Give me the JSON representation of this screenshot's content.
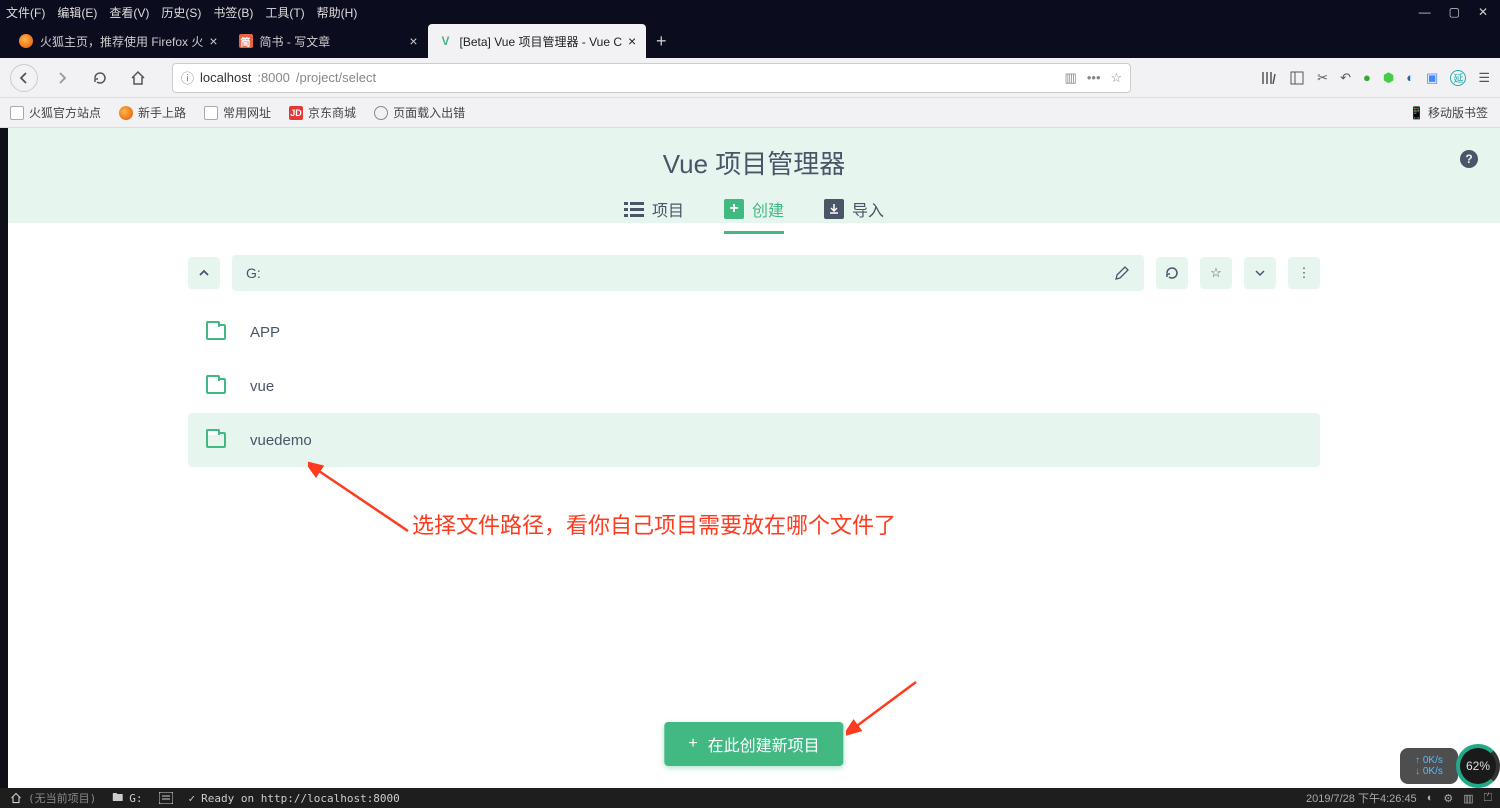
{
  "menubar": {
    "items": [
      "文件(F)",
      "编辑(E)",
      "查看(V)",
      "历史(S)",
      "书签(B)",
      "工具(T)",
      "帮助(H)"
    ]
  },
  "tabs": {
    "t0": {
      "title": "火狐主页，推荐使用 Firefox 火"
    },
    "t1": {
      "title": "简书 - 写文章"
    },
    "t2": {
      "title": "[Beta] Vue 项目管理器 - Vue C"
    }
  },
  "url": {
    "host": "localhost",
    "port": ":8000",
    "path": "/project/select"
  },
  "bookmarks": {
    "b0": "火狐官方站点",
    "b1": "新手上路",
    "b2": "常用网址",
    "b3": "京东商城",
    "b4": "页面载入出错",
    "mobile": "移动版书签"
  },
  "vue": {
    "title": "Vue 项目管理器",
    "tab_projects": "项目",
    "tab_create": "创建",
    "tab_import": "导入",
    "path": "G:",
    "folders": {
      "f0": "APP",
      "f1": "vue",
      "f2": "vuedemo"
    },
    "create_btn": "在此创建新项目"
  },
  "annotation": {
    "text": "选择文件路径，看你自己项目需要放在哪个文件了"
  },
  "status": {
    "home_project": "(无当前项目)",
    "drive": "G:",
    "ready": "Ready on http://localhost:8000"
  },
  "tray": {
    "datetime": "2019/7/28 下午4:26:45",
    "net_up": "0K/s",
    "net_down": "0K/s",
    "cpu": "62%"
  }
}
